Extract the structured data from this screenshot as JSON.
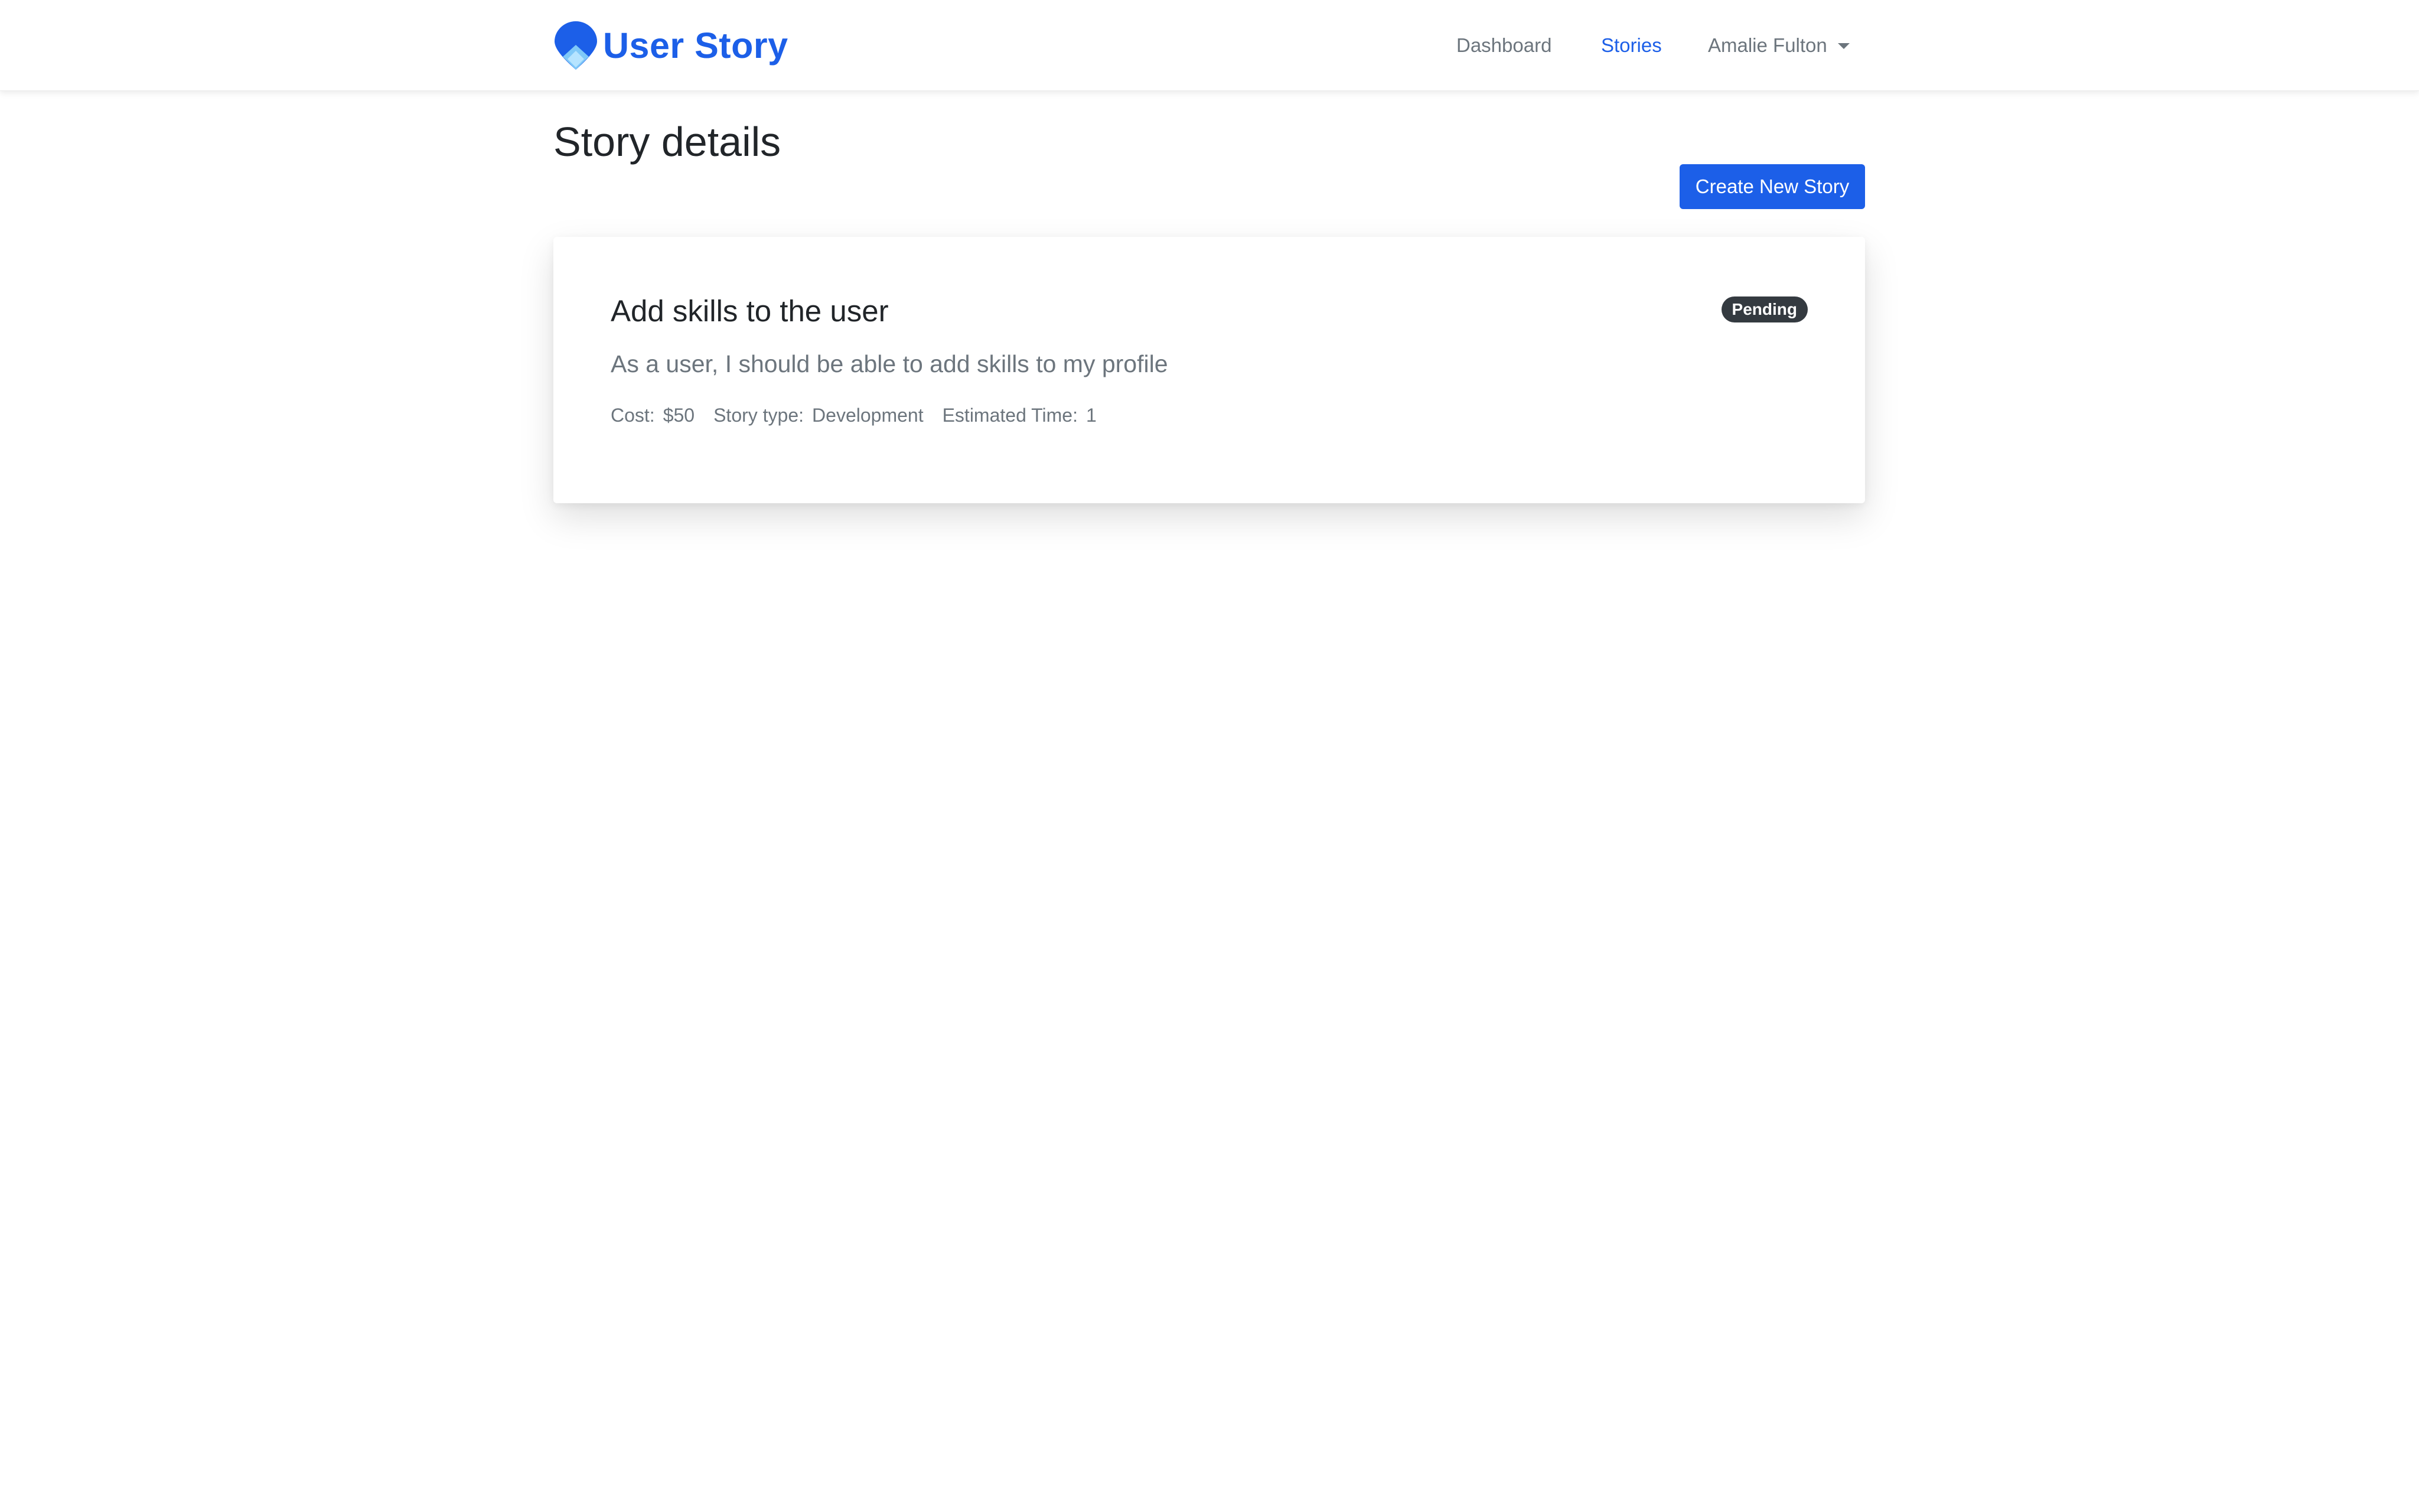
{
  "navbar": {
    "brand": "User Story",
    "links": {
      "dashboard": "Dashboard",
      "stories": "Stories"
    },
    "user_name": "Amalie Fulton",
    "active_color": "#1c5fe8"
  },
  "page": {
    "title": "Story details",
    "create_button": "Create New Story"
  },
  "story": {
    "title": "Add skills to the user",
    "status": "Pending",
    "description": "As a user, I should be able to add skills to my profile",
    "cost_label": "Cost:",
    "cost_value": "$50",
    "type_label": "Story type:",
    "type_value": "Development",
    "time_label": "Estimated Time:",
    "time_value": "1"
  },
  "colors": {
    "primary": "#1c5fe8",
    "badge": "#343a40",
    "muted": "#6c757d"
  },
  "icons": {
    "logo": "user-story-logo-icon",
    "dropdown": "chevron-down-icon"
  }
}
